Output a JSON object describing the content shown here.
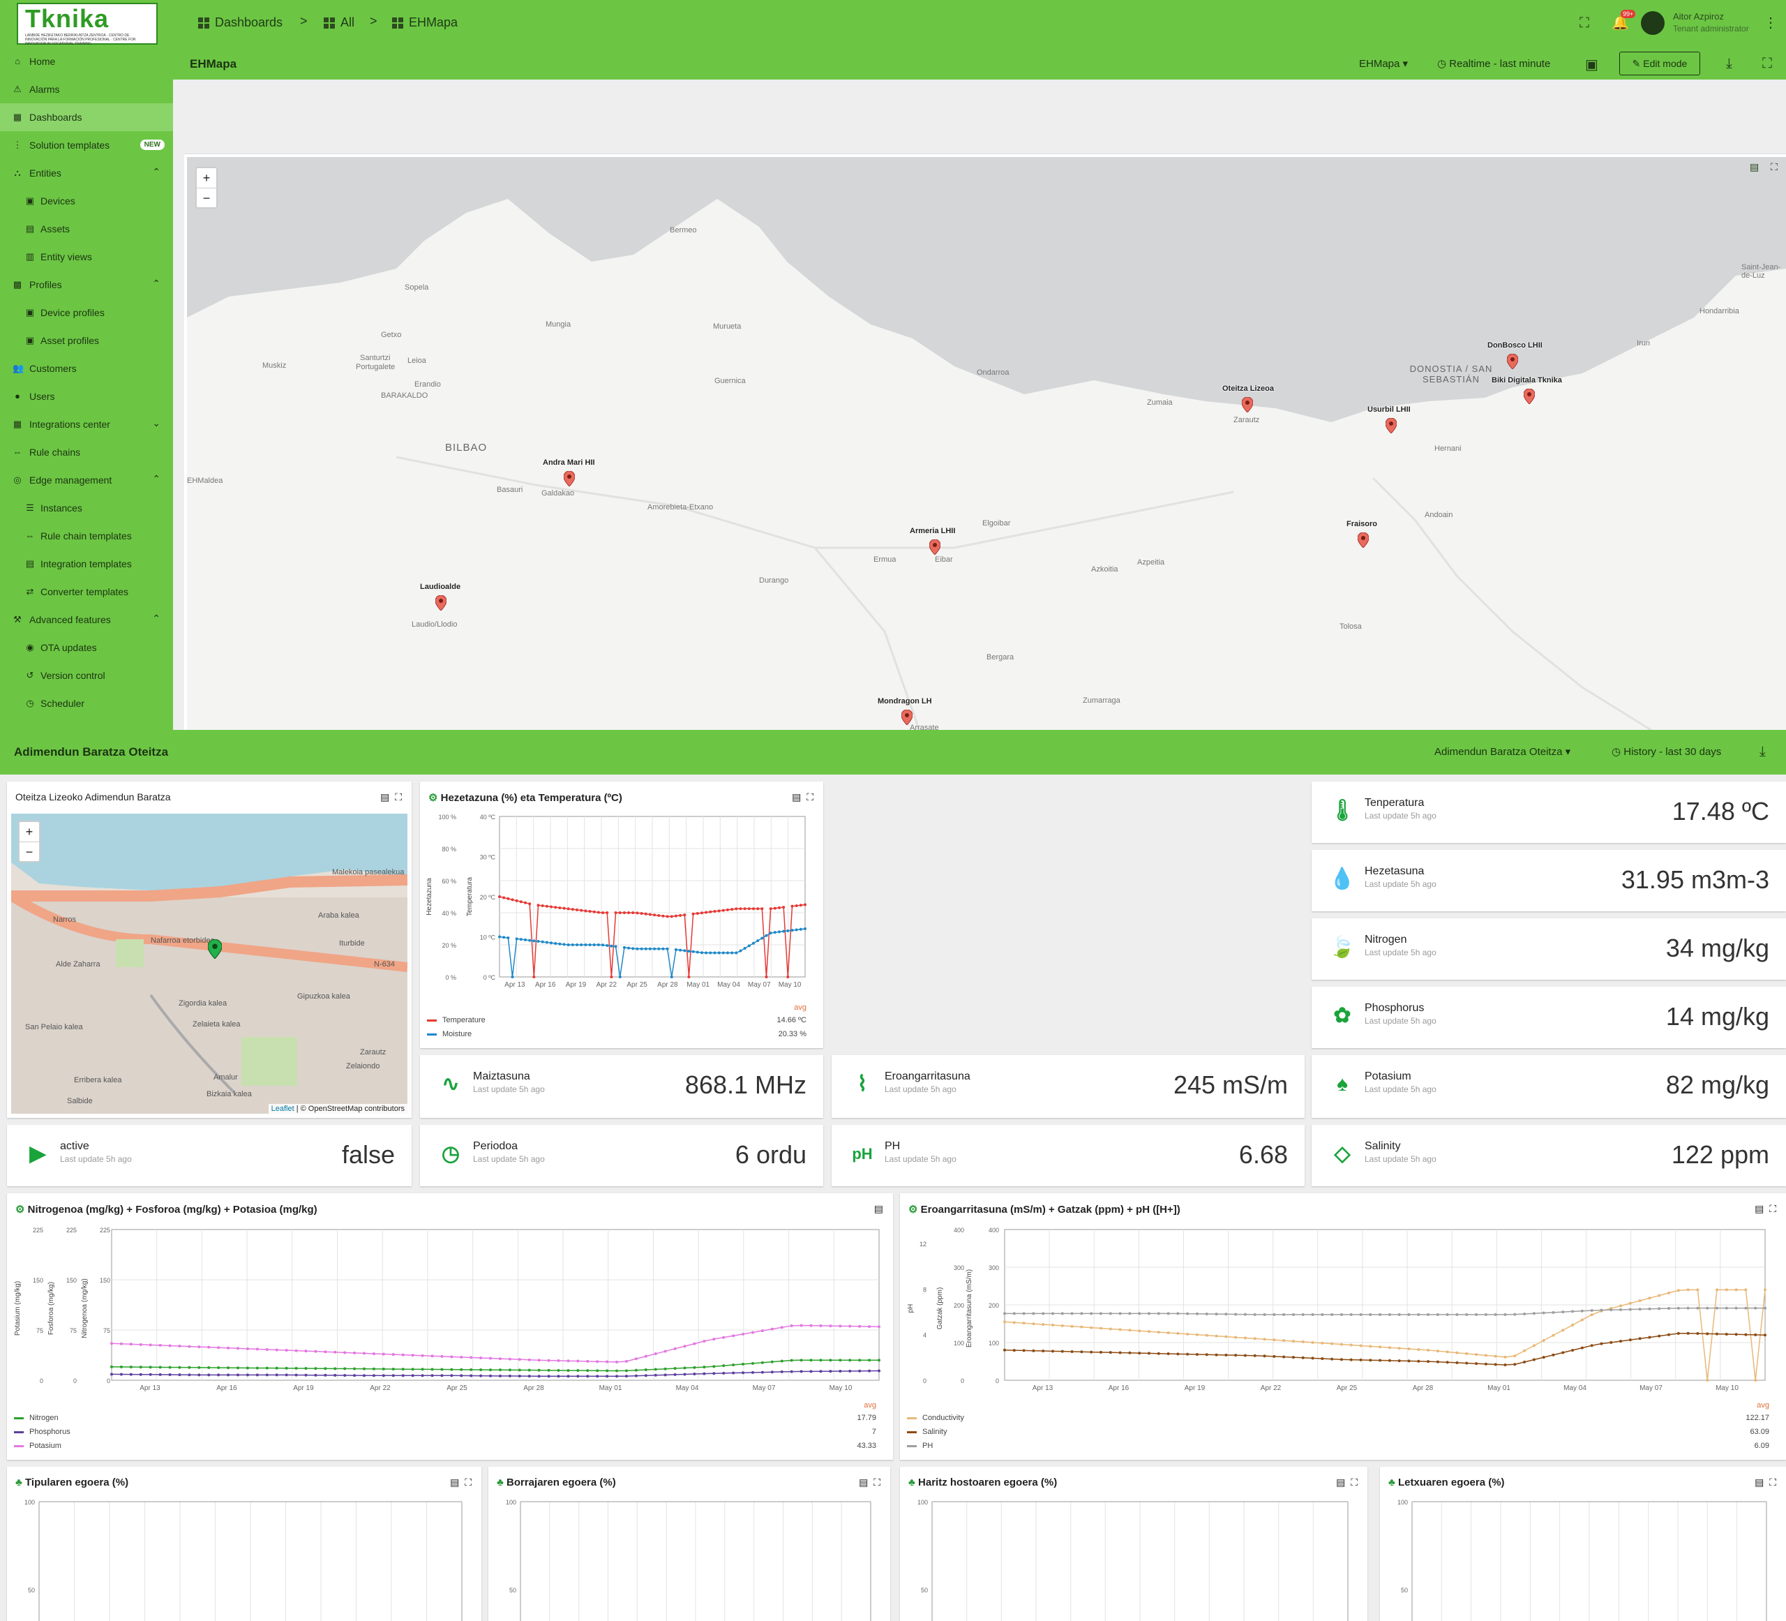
{
  "app": {
    "logo_text": "Tknika",
    "logo_subtitle": "LANBIDE HEZIKETAKO BERRIKUNTZA ZENTROA · CENTRO DE INNOVACIÓN PARA LA FORMACIÓN PROFESIONAL · CENTRE FOR INNOVATION IN VOCATIONAL TRAINING",
    "breadcrumb": [
      "Dashboards",
      "All",
      "EHMapa"
    ],
    "notification_count": "99+",
    "user_name": "Aitor Azpiroz",
    "user_role": "Tenant administrator",
    "accent_color": "#6cc644"
  },
  "sidebar": {
    "items": [
      {
        "label": "Home",
        "icon": "home-icon"
      },
      {
        "label": "Alarms",
        "icon": "alarm-icon"
      },
      {
        "label": "Dashboards",
        "icon": "dashboard-icon",
        "active": true
      },
      {
        "label": "Solution templates",
        "icon": "apps-icon",
        "badge": "NEW"
      },
      {
        "label": "Entities",
        "icon": "entities-icon",
        "expanded": true
      },
      {
        "label": "Devices",
        "icon": "devices-icon"
      },
      {
        "label": "Assets",
        "icon": "assets-icon"
      },
      {
        "label": "Entity views",
        "icon": "entity-views-icon"
      },
      {
        "label": "Profiles",
        "icon": "profiles-icon",
        "expanded": true
      },
      {
        "label": "Device profiles",
        "icon": "device-profile-icon"
      },
      {
        "label": "Asset profiles",
        "icon": "asset-profile-icon"
      },
      {
        "label": "Customers",
        "icon": "customers-icon"
      },
      {
        "label": "Users",
        "icon": "users-icon"
      },
      {
        "label": "Integrations center",
        "icon": "integrations-icon"
      },
      {
        "label": "Rule chains",
        "icon": "rule-chains-icon"
      },
      {
        "label": "Edge management",
        "icon": "edge-icon",
        "expanded": true
      },
      {
        "label": "Instances",
        "icon": "instances-icon"
      },
      {
        "label": "Rule chain templates",
        "icon": "rule-chain-templates-icon"
      },
      {
        "label": "Integration templates",
        "icon": "integration-templates-icon"
      },
      {
        "label": "Converter templates",
        "icon": "converter-templates-icon"
      },
      {
        "label": "Advanced features",
        "icon": "advanced-icon",
        "expanded": true
      },
      {
        "label": "OTA updates",
        "icon": "ota-icon"
      },
      {
        "label": "Version control",
        "icon": "version-control-icon"
      },
      {
        "label": "Scheduler",
        "icon": "scheduler-icon"
      }
    ]
  },
  "dashboard": {
    "title": "EHMapa",
    "state_selector": "EHMapa",
    "timewindow": "Realtime - last minute",
    "edit_label": "Edit mode"
  },
  "map": {
    "places": {
      "bermeo": "Bermeo",
      "sopela": "Sopela",
      "getxo": "Getxo",
      "mungia": "Mungia",
      "murueta": "Murueta",
      "gernika": "Guernica",
      "santurtzi": "Santurtzi",
      "portugalete": "Portugalete",
      "leioa": "Leioa",
      "barakaldo": "BARAKALDO",
      "erandio": "Erandio",
      "muskiz": "Muskiz",
      "bilbao": "BILBAO",
      "basauri": "Basauri",
      "galdakao": "Galdakao",
      "amorebieta": "Amorebieta-Etxano",
      "ondarroa": "Ondarroa",
      "zumaia": "Zumaia",
      "zarautz": "Zarautz",
      "donostia": "DONOSTIA / SAN SEBASTIÁN",
      "hondarribia": "Hondarribia",
      "irun": "Irun",
      "saintjean": "Saint-Jean-de-Luz",
      "hernani": "Hernani",
      "andoain": "Andoain",
      "elgoibar": "Elgoibar",
      "ermua": "Ermua",
      "eibar": "Eibar",
      "azkoitia": "Azkoitia",
      "azpeitia": "Azpeitia",
      "durango": "Durango",
      "tolosa": "Tolosa",
      "bergara": "Bergara",
      "zumarraga": "Zumarraga",
      "laudio": "Laudio/Llodio",
      "arrasate": "Arrasate",
      "ehmaldea": "EHMaldea"
    },
    "markers": [
      {
        "label": "DonBosco LHII"
      },
      {
        "label": "Biki Digitala Tknika"
      },
      {
        "label": "Oteitza Lizeoa"
      },
      {
        "label": "Usurbil LHII"
      },
      {
        "label": "Andra Mari HII"
      },
      {
        "label": "Armeria LHII"
      },
      {
        "label": "Fraisoro"
      },
      {
        "label": "Laudioalde"
      },
      {
        "label": "Mondragon LH"
      }
    ]
  },
  "section": {
    "title": "Adimendun Baratza Oteitza",
    "state_selector": "Adimendun Baratza Oteitza",
    "timewindow": "History - last 30 days"
  },
  "mini_map": {
    "title": "Oteitza Lizeoko Adimendun Baratza",
    "attribution_leaflet": "Leaflet",
    "attribution_osm": "| © OpenStreetMap contributors",
    "streets": [
      "Narros",
      "Alde Zaharra",
      "Nafarroa etorbidea",
      "N-634",
      "Malekoia pasealekua",
      "Gipuzkoa kalea",
      "Zigordia kalea",
      "Zelaieta kalea",
      "Erribera kalea",
      "Amalur",
      "Zelaiondo",
      "Salbide",
      "Zarautz",
      "San Pelaio kalea",
      "Araba kalea",
      "Bizkaia kalea",
      "Iturbide"
    ]
  },
  "kv": [
    {
      "label": "Tenperatura",
      "value": "17.48 ºC",
      "updated": "Last update 5h ago",
      "icon": "thermometer-icon"
    },
    {
      "label": "Hezetasuna",
      "value": "31.95 m3m-3",
      "updated": "Last update 5h ago",
      "icon": "humidity-icon"
    },
    {
      "label": "Nitrogen",
      "value": "34 mg/kg",
      "updated": "Last update 5h ago",
      "icon": "leaf-icon"
    },
    {
      "label": "Phosphorus",
      "value": "14 mg/kg",
      "updated": "Last update 5h ago",
      "icon": "flower-icon"
    },
    {
      "label": "Potasium",
      "value": "82 mg/kg",
      "updated": "Last update 5h ago",
      "icon": "tree-icon"
    },
    {
      "label": "Salinity",
      "value": "122 ppm",
      "updated": "Last update 5h ago",
      "icon": "diamond-icon"
    },
    {
      "label": "Maiztasuna",
      "value": "868.1 MHz",
      "updated": "Last update 5h ago",
      "icon": "wave-icon"
    },
    {
      "label": "Eroangarritasuna",
      "value": "245 mS/m",
      "updated": "Last update 5h ago",
      "icon": "pulse-icon"
    },
    {
      "label": "active",
      "value": "false",
      "updated": "Last update 5h ago",
      "icon": "play-icon"
    },
    {
      "label": "Periodoa",
      "value": "6 ordu",
      "updated": "Last update 5h ago",
      "icon": "clock-icon"
    },
    {
      "label": "PH",
      "value": "6.68",
      "updated": "Last update 5h ago",
      "icon": "ph-icon"
    }
  ],
  "charts": {
    "temp": {
      "title": "Hezetazuna (%) eta Temperatura (ºC)",
      "avg_label": "avg",
      "legend": [
        {
          "name": "Temperature",
          "avg": "14.66 ºC",
          "color": "#e53935"
        },
        {
          "name": "Moisture",
          "avg": "20.33 %",
          "color": "#1e88c7"
        }
      ],
      "yleft_title": "Hezetazuna",
      "yright_title": "Temperatura",
      "yleft_ticks": [
        "100 %",
        "80 %",
        "60 %",
        "40 %",
        "20 %",
        "0 %"
      ],
      "yright_ticks": [
        "40 ºC",
        "30 ºC",
        "20 ºC",
        "10 ºC",
        "0 ºC"
      ],
      "x_ticks": [
        "Apr 13",
        "Apr 16",
        "Apr 19",
        "Apr 22",
        "Apr 25",
        "Apr 28",
        "May 01",
        "May 04",
        "May 07",
        "May 10"
      ]
    },
    "npk": {
      "title": "Nitrogenoa (mg/kg) + Fosforoa (mg/kg) + Potasioa (mg/kg)",
      "avg_label": "avg",
      "legend": [
        {
          "name": "Nitrogen",
          "avg": "17.79",
          "color": "#2ca02c"
        },
        {
          "name": "Phosphorus",
          "avg": "7",
          "color": "#5b3f9e"
        },
        {
          "name": "Potasium",
          "avg": "43.33",
          "color": "#e377e0"
        }
      ],
      "y_titles": [
        "Potasium (mg/kg)",
        "Fosforoa (mg/kg)",
        "Nitrogenoa (mg/kg)"
      ],
      "y_ticks": [
        "225",
        "150",
        "75",
        "0"
      ],
      "x_ticks": [
        "Apr 13",
        "Apr 16",
        "Apr 19",
        "Apr 22",
        "Apr 25",
        "Apr 28",
        "May 01",
        "May 04",
        "May 07",
        "May 10"
      ]
    },
    "cond": {
      "title": "Eroangarritasuna (mS/m) + Gatzak (ppm) + pH ([H+])",
      "avg_label": "avg",
      "legend": [
        {
          "name": "Conductivity",
          "avg": "122.17",
          "color": "#e8b877"
        },
        {
          "name": "Salinity",
          "avg": "63.09",
          "color": "#8b4a12"
        },
        {
          "name": "PH",
          "avg": "6.09",
          "color": "#9e9e9e"
        }
      ],
      "y_titles": [
        "pH",
        "Gatzak (ppm)",
        "Eroangarritasuna (mS/m)"
      ],
      "ph_ticks": [
        "12",
        "8",
        "4",
        "0"
      ],
      "ppm_ticks": [
        "400",
        "300",
        "200",
        "100",
        "0"
      ],
      "x_ticks": [
        "Apr 13",
        "Apr 16",
        "Apr 19",
        "Apr 22",
        "Apr 25",
        "Apr 28",
        "May 01",
        "May 04",
        "May 07",
        "May 10"
      ]
    },
    "plants": [
      {
        "title": "Tipularen egoera (%)"
      },
      {
        "title": "Borrajaren egoera (%)"
      },
      {
        "title": "Haritz hostoaren egoera (%)"
      },
      {
        "title": "Letxuaren egoera (%)"
      }
    ],
    "plant_ticks": [
      "100",
      "50"
    ]
  },
  "chart_data": [
    {
      "type": "line",
      "title": "Hezetazuna (%) eta Temperatura (ºC)",
      "x": [
        "Apr 13",
        "Apr 16",
        "Apr 19",
        "Apr 22",
        "Apr 25",
        "Apr 28",
        "May 01",
        "May 04",
        "May 07",
        "May 10"
      ],
      "series": [
        {
          "name": "Temperature",
          "values": [
            20,
            18,
            17,
            16,
            16,
            15,
            16,
            17,
            17,
            18
          ]
        },
        {
          "name": "Moisture",
          "values": [
            10,
            9,
            8,
            8,
            7,
            7,
            6,
            6,
            11,
            12
          ]
        }
      ],
      "ylim": [
        0,
        40
      ]
    },
    {
      "type": "line",
      "title": "Nitrogenoa (mg/kg) + Fosforoa (mg/kg) + Potasioa (mg/kg)",
      "x": [
        "Apr 13",
        "Apr 16",
        "Apr 19",
        "Apr 22",
        "Apr 25",
        "Apr 28",
        "May 01",
        "May 04",
        "May 07",
        "May 10"
      ],
      "series": [
        {
          "name": "Nitrogen",
          "values": [
            20,
            19,
            18,
            17,
            16,
            15,
            14,
            20,
            30,
            30
          ]
        },
        {
          "name": "Phosphorus",
          "values": [
            9,
            8,
            8,
            7,
            7,
            6,
            6,
            10,
            13,
            14
          ]
        },
        {
          "name": "Potasium",
          "values": [
            55,
            50,
            45,
            40,
            35,
            30,
            27,
            60,
            82,
            80
          ]
        }
      ],
      "ylim": [
        0,
        225
      ]
    },
    {
      "type": "line",
      "title": "Eroangarritasuna (mS/m) + Gatzak (ppm) + pH ([H+])",
      "x": [
        "Apr 13",
        "Apr 16",
        "Apr 19",
        "Apr 22",
        "Apr 25",
        "Apr 28",
        "May 01",
        "May 04",
        "May 07",
        "May 10"
      ],
      "series": [
        {
          "name": "Conductivity",
          "values": [
            155,
            140,
            125,
            110,
            95,
            80,
            60,
            180,
            240,
            240
          ]
        },
        {
          "name": "Salinity",
          "values": [
            80,
            75,
            70,
            65,
            55,
            50,
            40,
            95,
            125,
            120
          ]
        },
        {
          "name": "PH",
          "values": [
            6.2,
            6.2,
            6.2,
            6.1,
            6.1,
            6.1,
            6.1,
            6.5,
            6.7,
            6.7
          ]
        }
      ],
      "ylim": [
        0,
        400
      ]
    }
  ]
}
